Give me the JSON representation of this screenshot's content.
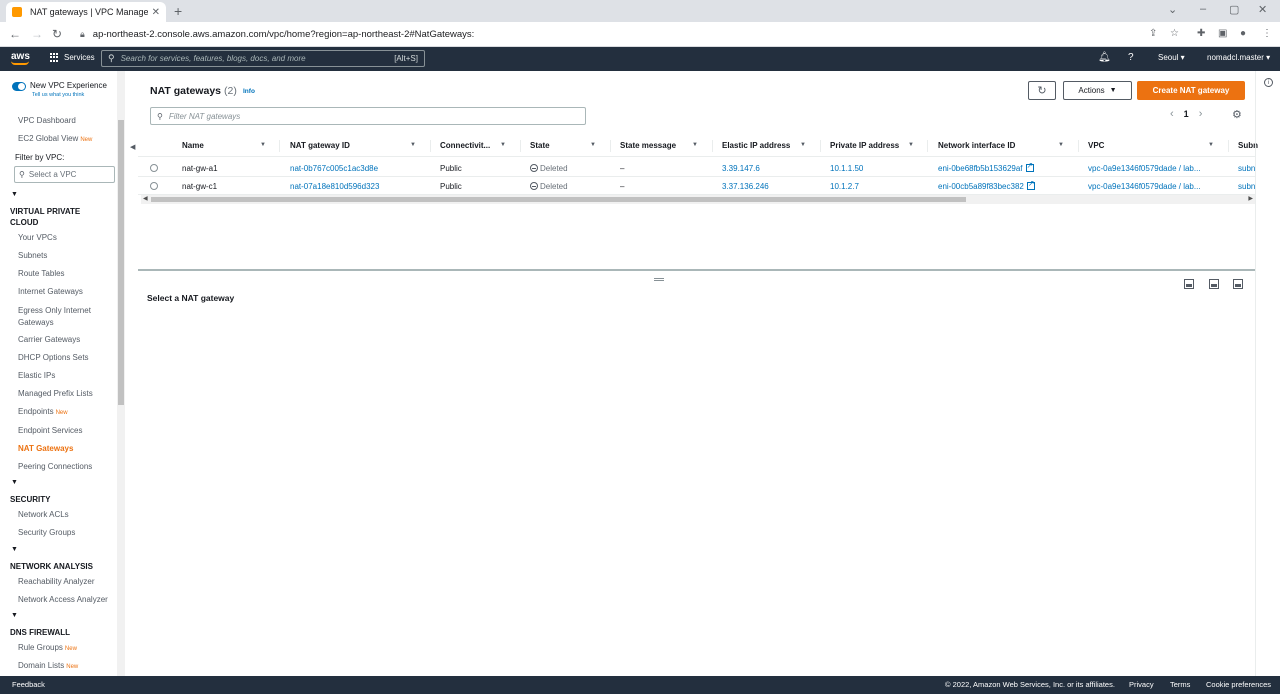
{
  "browser": {
    "tab_title": "NAT gateways | VPC Management",
    "url": "ap-northeast-2.console.aws.amazon.com/vpc/home?region=ap-northeast-2#NatGateways:"
  },
  "awsnav": {
    "logo": "aws",
    "services": "Services",
    "search_placeholder": "Search for services, features, blogs, docs, and more",
    "search_shortcut": "[Alt+S]",
    "region": "Seoul ▾",
    "account": "nomadcl.master ▾"
  },
  "sidebar": {
    "new_vpc_experience": "New VPC Experience",
    "tell_us": "Tell us what you think",
    "vpc_dashboard": "VPC Dashboard",
    "ec2_global_view": "EC2 Global View",
    "new_badge": "New",
    "filter_by_vpc": "Filter by VPC:",
    "select_vpc_placeholder": "Select a VPC",
    "sections": {
      "virtual_private_cloud": "VIRTUAL PRIVATE CLOUD",
      "security": "SECURITY",
      "network_analysis": "NETWORK ANALYSIS",
      "dns_firewall": "DNS FIREWALL"
    },
    "vpc_items": [
      "Your VPCs",
      "Subnets",
      "Route Tables",
      "Internet Gateways",
      "Egress Only Internet Gateways",
      "Carrier Gateways",
      "DHCP Options Sets",
      "Elastic IPs",
      "Managed Prefix Lists",
      "Endpoints",
      "Endpoint Services",
      "NAT Gateways",
      "Peering Connections"
    ],
    "security_items": [
      "Network ACLs",
      "Security Groups"
    ],
    "analysis_items": [
      "Reachability Analyzer",
      "Network Access Analyzer"
    ],
    "dns_items": [
      "Rule Groups",
      "Domain Lists"
    ]
  },
  "main": {
    "title": "NAT gateways",
    "count": "(2)",
    "info": "Info",
    "actions": "Actions",
    "create": "Create NAT gateway",
    "filter_placeholder": "Filter NAT gateways",
    "page": "1"
  },
  "table": {
    "columns": [
      "Name",
      "NAT gateway ID",
      "Connectivit...",
      "State",
      "State message",
      "Elastic IP address",
      "Private IP address",
      "Network interface ID",
      "VPC",
      "Subn"
    ],
    "rows": [
      {
        "name": "nat-gw-a1",
        "id": "nat-0b767c005c1ac3d8e",
        "connectivity": "Public",
        "state": "Deleted",
        "message": "–",
        "eip": "3.39.147.6",
        "private_ip": "10.1.1.50",
        "eni": "eni-0be68fb5b153629af",
        "vpc": "vpc-0a9e1346f0579dade / lab...",
        "subnet": "subn"
      },
      {
        "name": "nat-gw-c1",
        "id": "nat-07a18e810d596d323",
        "connectivity": "Public",
        "state": "Deleted",
        "message": "–",
        "eip": "3.37.136.246",
        "private_ip": "10.1.2.7",
        "eni": "eni-00cb5a89f83bec382",
        "vpc": "vpc-0a9e1346f0579dade / lab...",
        "subnet": "subn"
      }
    ]
  },
  "split": {
    "title": "Select a NAT gateway"
  },
  "footer": {
    "feedback": "Feedback",
    "copyright": "© 2022, Amazon Web Services, Inc. or its affiliates.",
    "privacy": "Privacy",
    "terms": "Terms",
    "cookies": "Cookie preferences"
  }
}
